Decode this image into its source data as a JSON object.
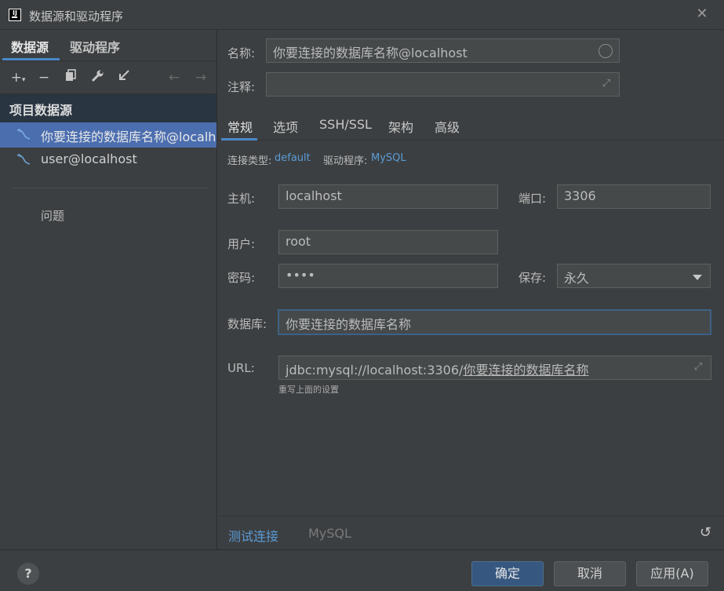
{
  "window": {
    "title": "数据源和驱动程序"
  },
  "left": {
    "tabs": [
      {
        "label": "数据源"
      },
      {
        "label": "驱动程序"
      }
    ],
    "group_header": "项目数据源",
    "items": [
      {
        "label": "你要连接的数据库名称@localhost"
      },
      {
        "label": "user@localhost"
      }
    ],
    "problems_label": "问题"
  },
  "form": {
    "name_label": "名称:",
    "name_value": "你要连接的数据库名称@localhost",
    "comment_label": "注释:",
    "comment_value": "",
    "tabs": [
      {
        "label": "常规"
      },
      {
        "label": "选项"
      },
      {
        "label": "SSH/SSL"
      },
      {
        "label": "架构"
      },
      {
        "label": "高级"
      }
    ],
    "conn_type_label": "连接类型:",
    "conn_type_value": "default",
    "driver_label": "驱动程序:",
    "driver_value": "MySQL",
    "host_label": "主机:",
    "host_value": "localhost",
    "port_label": "端口:",
    "port_value": "3306",
    "user_label": "用户:",
    "user_value": "root",
    "password_label": "密码:",
    "password_value": "••••",
    "save_label": "保存:",
    "save_value": "永久",
    "database_label": "数据库:",
    "database_value": "你要连接的数据库名称",
    "url_label": "URL:",
    "url_prefix": "jdbc:mysql://localhost:3306/",
    "url_suffix": "你要连接的数据库名称",
    "url_hint": "重写上面的设置"
  },
  "bottom": {
    "test_connection": "测试连接",
    "driver_name": "MySQL"
  },
  "footer": {
    "help": "?",
    "ok": "确定",
    "cancel": "取消",
    "apply": "应用(A)"
  },
  "colors": {
    "accent": "#4a88c7",
    "link": "#5a9bd6",
    "selection": "#4b6eaf",
    "primary_button": "#365880"
  }
}
